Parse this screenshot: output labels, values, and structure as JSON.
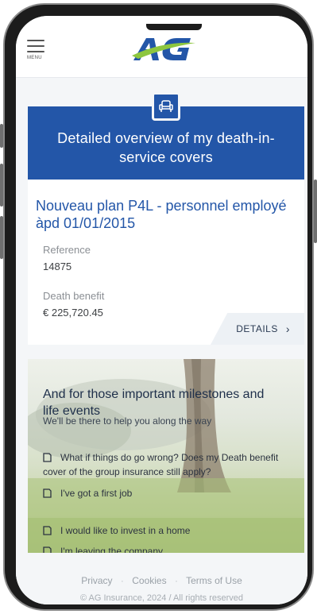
{
  "header": {
    "menu_label": "MENU",
    "logo_text": "AG"
  },
  "cover": {
    "title": "Detailed overview of my death-in-service covers",
    "plan_title": "Nouveau plan P4L - personnel employé àpd 01/01/2015",
    "reference_label": "Reference",
    "reference_value": "14875",
    "death_benefit_label": "Death benefit",
    "death_benefit_value": "€ 225,720.45",
    "details_label": "DETAILS"
  },
  "milestones": {
    "title_line1": "And for those important milestones and",
    "title_line2": "life events",
    "subtitle": "We'll be there to help you along the way",
    "links": [
      "What if things do go wrong? Does my Death benefit",
      "cover of the group insurance still apply?",
      "I've got a first job",
      "I would like to invest in a home",
      "I'm leaving the company"
    ]
  },
  "footer": {
    "privacy": "Privacy",
    "cookies": "Cookies",
    "terms": "Terms of Use",
    "separator": "·",
    "copyright": "© AG Insurance, 2024 / All rights reserved"
  },
  "colors": {
    "brand_blue": "#2356a8",
    "logo_green": "#8dc63f"
  }
}
